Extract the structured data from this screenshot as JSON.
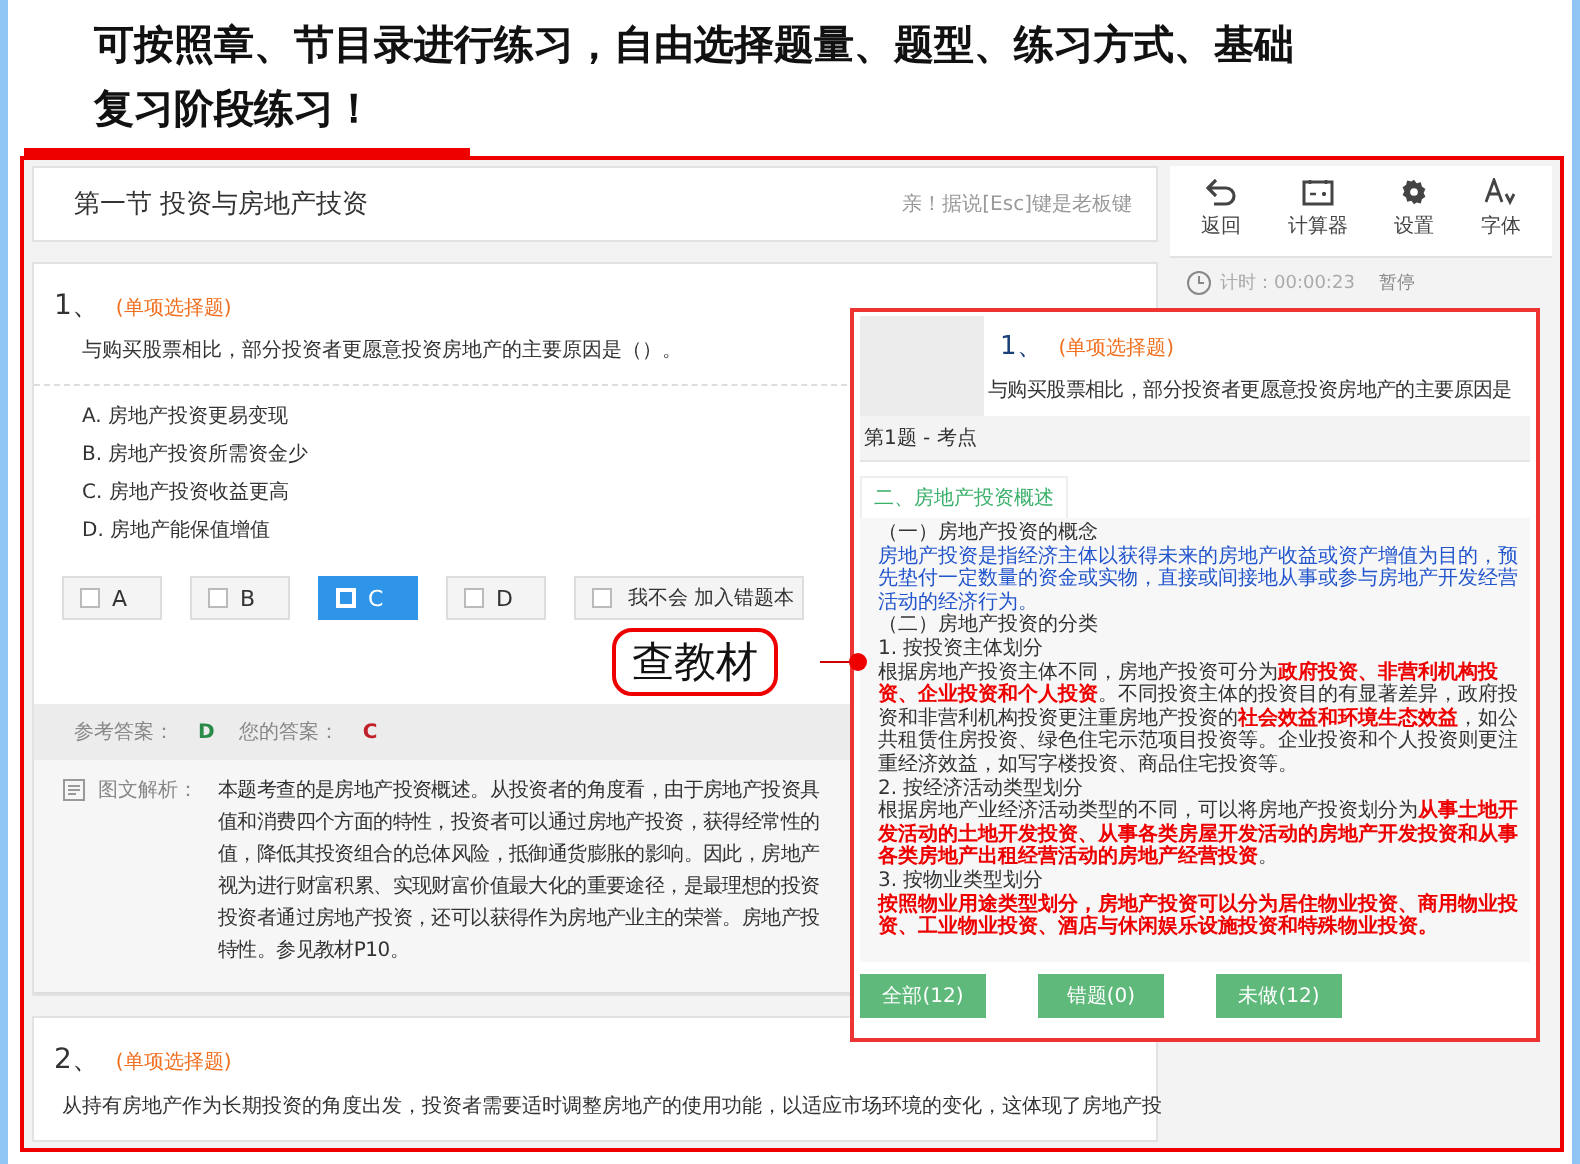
{
  "headline": "可按照章、节目录进行练习，自由选择题量、题型、练习方式、基础复习阶段练习！",
  "section_title": "第一节 投资与房地产技资",
  "hint": "亲！据说[Esc]键是老板键",
  "toolbar": [
    {
      "kind": "back",
      "label": "返回"
    },
    {
      "kind": "calculator",
      "label": "计算器"
    },
    {
      "kind": "settings",
      "label": "设置"
    },
    {
      "kind": "font",
      "label": "字体"
    }
  ],
  "timer": {
    "label": "计时：00:00:23",
    "pause": "暂停"
  },
  "question": {
    "number": "1、",
    "type": "(单项选择题)",
    "text": "与购买股票相比，部分投资者更愿意投资房地产的主要原因是（）。",
    "options": [
      "A. 房地产投资更易变现",
      "B. 房地产投资所需资金少",
      "C. 房地产投资收益更高",
      "D. 房地产能保值增值"
    ],
    "answers": [
      {
        "label": "A",
        "selected": false
      },
      {
        "label": "B",
        "selected": false
      },
      {
        "label": "C",
        "selected": true
      },
      {
        "label": "D",
        "selected": false
      }
    ],
    "dont_know": {
      "label": "我不会 加入错题本",
      "checked": false
    },
    "reference_label": "参考答案：",
    "reference": "D",
    "yours_label": "您的答案：",
    "yours": "C",
    "explanation_label": "图文解析：",
    "explanation_lines": [
      "本题考查的是房地产投资概述。从投资者的角度看，由于房地产投资具",
      "值和消费四个方面的特性，投资者可以通过房地产投资，获得经常性的",
      "值，降低其投资组合的总体风险，抵御通货膨胀的影响。因此，房地产",
      "视为进行财富积累、实现财富价值最大化的重要途径，是最理想的投资",
      "投资者通过房地产投资，还可以获得作为房地产业主的荣誉。房地产投",
      "特性。参见教材P10。"
    ]
  },
  "question_2": {
    "number": "2、",
    "type": "(单项选择题)",
    "text": "从持有房地产作为长期投资的角度出发，投资者需要适时调整房地产的使用功能，以适应市场环境的变化，这体现了房地产投"
  },
  "callout": "查教材",
  "textbook_panel": {
    "question_number": "1、",
    "question_type": "(单项选择题)",
    "question_text": "与购买股票相比，部分投资者更愿意投资房地产的主要原因是",
    "point_title": "第1题 - 考点",
    "tab": "二、房地产投资概述",
    "paragraphs": [
      {
        "kind": "plain",
        "segments": [
          {
            "text": "（一）房地产投资的概念",
            "highlight": false
          }
        ]
      },
      {
        "kind": "definition",
        "segments": [
          {
            "text": "房地产投资是指经济主体以获得未来的房地产收益或资产增值为目的，预先垫付一定数量的资金或实物，直接或间接地从事或参与房地产开发经营活动的经济行为。",
            "highlight": false
          }
        ]
      },
      {
        "kind": "plain",
        "segments": [
          {
            "text": "（二）房地产投资的分类",
            "highlight": false
          }
        ]
      },
      {
        "kind": "plain",
        "segments": [
          {
            "text": "1. 按投资主体划分",
            "highlight": false
          }
        ]
      },
      {
        "kind": "plain",
        "segments": [
          {
            "text": "根据房地产投资主体不同，房地产投资可分为",
            "highlight": false
          },
          {
            "text": "政府投资、非营利机构投资、企业投资和个人投资",
            "highlight": true
          },
          {
            "text": "。不同投资主体的投资目的有显著差异，政府投资和非营利机构投资更注重房地产投资的",
            "highlight": false
          },
          {
            "text": "社会效益和环境生态效益",
            "highlight": true
          },
          {
            "text": "，如公共租赁住房投资、绿色住宅示范项目投资等。企业投资和个人投资则更注重经济效益，如写字楼投资、商品住宅投资等。",
            "highlight": false
          }
        ]
      },
      {
        "kind": "plain",
        "segments": [
          {
            "text": "2. 按经济活动类型划分",
            "highlight": false
          }
        ]
      },
      {
        "kind": "plain",
        "segments": [
          {
            "text": "根据房地产业经济活动类型的不同，可以将房地产投资划分为",
            "highlight": false
          },
          {
            "text": "从事土地开发活动的土地开发投资、从事各类房屋开发活动的房地产开发投资和从事各类房地产出租经营活动的房地产经营投资",
            "highlight": true
          },
          {
            "text": "。",
            "highlight": false
          }
        ]
      },
      {
        "kind": "plain",
        "segments": [
          {
            "text": "3. 按物业类型划分",
            "highlight": false
          }
        ]
      },
      {
        "kind": "plain",
        "segments": [
          {
            "text": "按照物业用途类型划分，房地产投资可以分为居住物业投资、商用物业投资、工业物业投资、酒店与休闲娱乐设施投资和特殊物业投资。",
            "highlight": true
          }
        ]
      }
    ],
    "filters": [
      "全部(12)",
      "错题(0)",
      "未做(12)"
    ]
  }
}
